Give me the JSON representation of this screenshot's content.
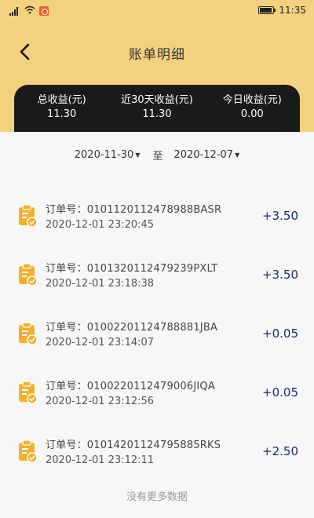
{
  "status_bar": {
    "time": "11:35"
  },
  "header": {
    "title": "账单明细"
  },
  "stats": [
    {
      "label": "总收益(元)",
      "value": "11.30"
    },
    {
      "label": "近30天收益(元)",
      "value": "11.30"
    },
    {
      "label": "今日收益(元)",
      "value": "0.00"
    }
  ],
  "date_range": {
    "start": "2020-11-30",
    "separator": "至",
    "end": "2020-12-07"
  },
  "orders": [
    {
      "order_no": "订单号：0101120112478988BASR",
      "time": "2020-12-01 23:20:45",
      "amount": "+3.50"
    },
    {
      "order_no": "订单号：0101320112479239PXLT",
      "time": "2020-12-01 23:18:38",
      "amount": "+3.50"
    },
    {
      "order_no": "订单号：01002201124788881JBA",
      "time": "2020-12-01 23:14:07",
      "amount": "+0.05"
    },
    {
      "order_no": "订单号：0100220112479006JIQA",
      "time": "2020-12-01 23:12:56",
      "amount": "+0.05"
    },
    {
      "order_no": "订单号：01014201124795885RKS",
      "time": "2020-12-01 23:12:11",
      "amount": "+2.50"
    }
  ],
  "footer": {
    "no_more": "没有更多数据"
  },
  "colors": {
    "header_bg": "#f3d17f",
    "card_bg": "#1a1a1a",
    "amount": "#1c2a6e",
    "icon": "#f2b12a"
  }
}
